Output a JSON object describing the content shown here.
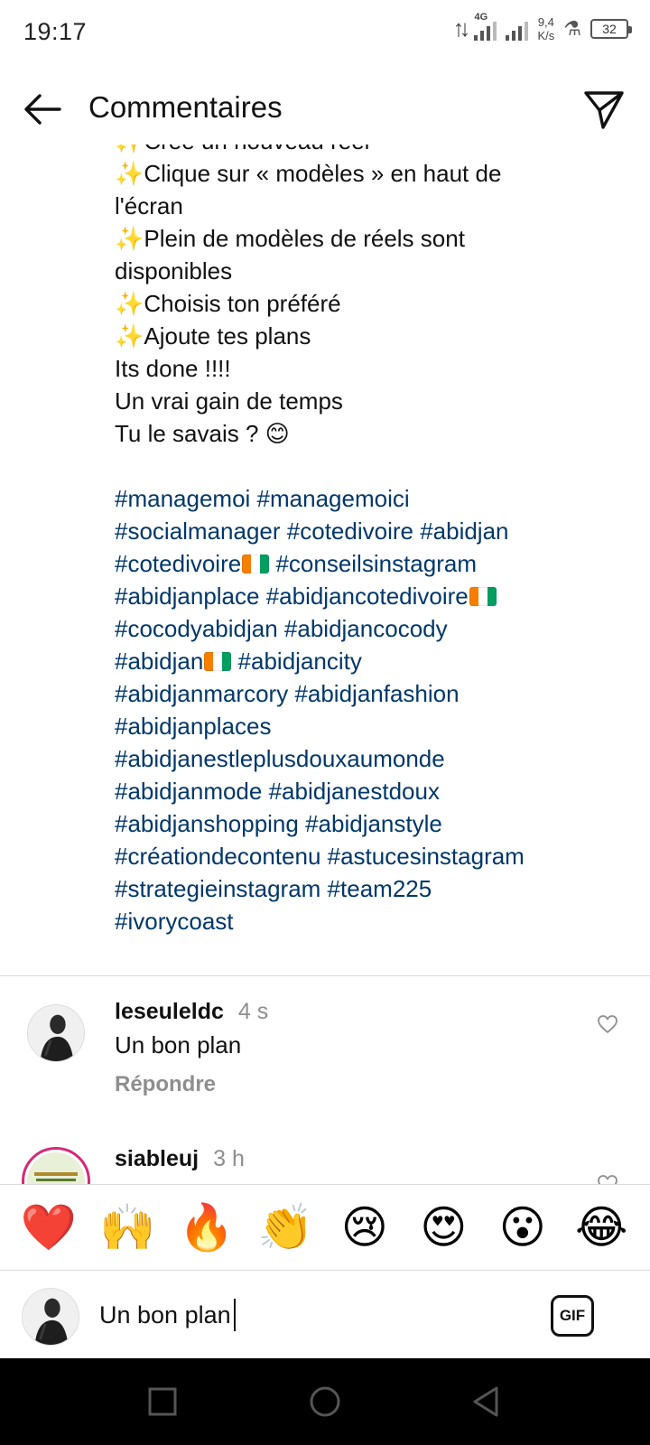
{
  "status_bar": {
    "time": "19:17",
    "network_type": "4G",
    "net_speed_value": "9,4",
    "net_speed_unit": "K/s",
    "battery": "32"
  },
  "header": {
    "title": "Commentaires",
    "back_icon": "arrow-left-icon",
    "send_icon": "paper-plane-icon"
  },
  "caption": {
    "lines": [
      "✨Crée un nouveau reel",
      "✨Clique sur « modèles » en haut de",
      "l'écran",
      "✨Plein de modèles de réels sont",
      "disponibles",
      "✨Choisis ton préféré",
      "✨Ajoute tes plans",
      "Its done !!!!",
      "Un vrai gain de temps",
      "Tu le savais ? 😊"
    ],
    "hashtag_lines": [
      "#managemoi #managemoici",
      "#socialmanager #cotedivoire #abidjan",
      "#cotedivoire",
      "#conseilsinstagram",
      "#abidjanplace #abidjancotedivoire",
      "#cocodyabidjan #abidjancocody",
      "#abidjan",
      "#abidjancity",
      "#abidjanmarcory #abidjanfashion",
      "#abidjanplaces",
      "#abidjanestleplusdouxaumonde",
      "#abidjanmode #abidjanestdoux",
      "#abidjanshopping #abidjanstyle",
      "#créationdecontenu #astucesinstagram",
      "#strategieinstagram #team225",
      "#ivorycoast"
    ],
    "hashtag_color": "#00376b"
  },
  "comments": [
    {
      "username": "leseuleldc",
      "time": "4 s",
      "text": "Un bon plan",
      "reply_label": "Répondre"
    },
    {
      "username": "siableuj",
      "time": "3 h"
    }
  ],
  "emoji_bar": [
    "❤️",
    "🙌",
    "🔥",
    "👏",
    "😢",
    "😍",
    "😮",
    "😂"
  ],
  "input": {
    "value": "Un bon plan",
    "gif_label": "GIF"
  },
  "nav": {
    "recents_icon": "square-icon",
    "home_icon": "circle-icon",
    "back_icon": "triangle-back-icon"
  }
}
